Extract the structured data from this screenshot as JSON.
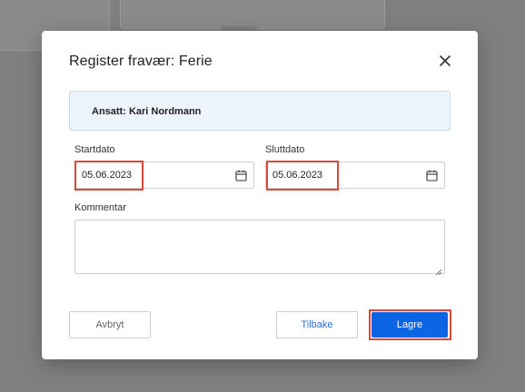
{
  "dialog": {
    "title": "Register fravær: Ferie",
    "employee": "Ansatt: Kari Nordmann"
  },
  "form": {
    "start_label": "Startdato",
    "start_value": "05.06.2023",
    "end_label": "Sluttdato",
    "end_value": "05.06.2023",
    "comment_label": "Kommentar",
    "comment_value": ""
  },
  "buttons": {
    "cancel": "Avbryt",
    "back": "Tilbake",
    "save": "Lagre"
  },
  "colors": {
    "primary": "#0c66e4",
    "highlight": "#d9483b",
    "info_bg": "#eef4fc"
  },
  "icons": {
    "close": "close-icon",
    "calendar": "calendar-icon"
  }
}
